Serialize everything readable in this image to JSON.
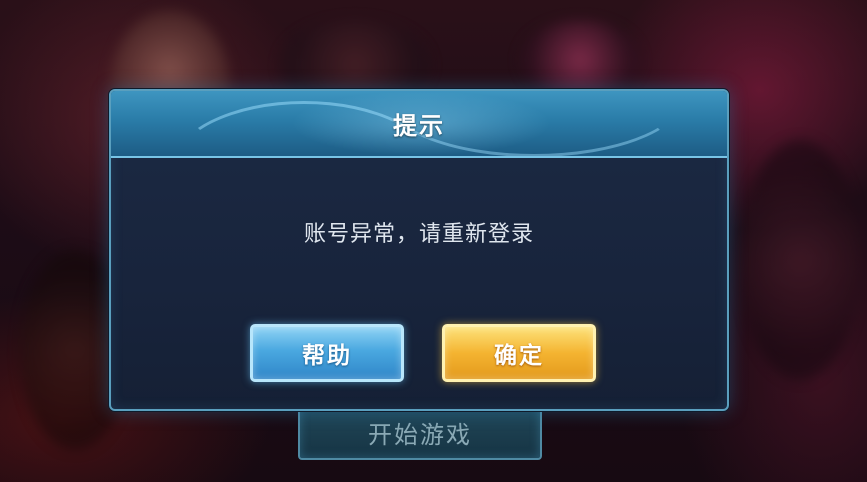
{
  "background": {
    "start_button_label": "开始游戏"
  },
  "dialog": {
    "title": "提示",
    "message": "账号异常，请重新登录",
    "buttons": {
      "help_label": "帮助",
      "confirm_label": "确定"
    }
  },
  "colors": {
    "dialog_border": "#5a9fbe",
    "header_blue": "#2a7ca8",
    "help_button_blue": "#4aa8e0",
    "confirm_button_gold": "#f4b431"
  }
}
